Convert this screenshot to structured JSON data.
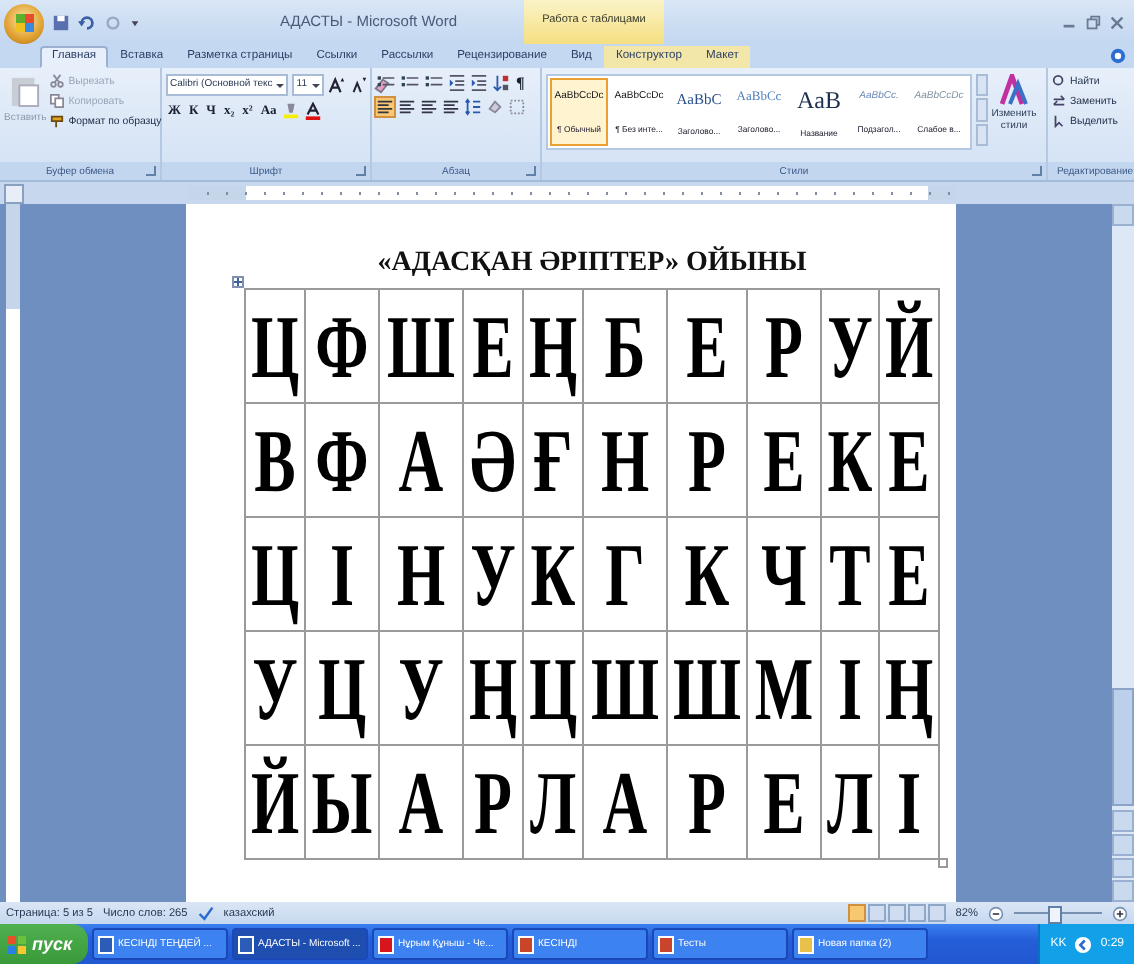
{
  "title_bar": {
    "title": "АДАСТЫ - Microsoft Word",
    "context_tab": "Работа с таблицами"
  },
  "tabs": [
    {
      "label": "Главная",
      "selected": true,
      "kind": "main"
    },
    {
      "label": "Вставка",
      "selected": false,
      "kind": "main"
    },
    {
      "label": "Разметка страницы",
      "selected": false,
      "kind": "main"
    },
    {
      "label": "Ссылки",
      "selected": false,
      "kind": "main"
    },
    {
      "label": "Рассылки",
      "selected": false,
      "kind": "main"
    },
    {
      "label": "Рецензирование",
      "selected": false,
      "kind": "main"
    },
    {
      "label": "Вид",
      "selected": false,
      "kind": "main"
    },
    {
      "label": "Конструктор",
      "selected": false,
      "kind": "context"
    },
    {
      "label": "Макет",
      "selected": false,
      "kind": "context"
    }
  ],
  "clipboard": {
    "paste": "Вставить",
    "items": [
      {
        "label": "Вырезать",
        "disabled": true,
        "kind": "cut"
      },
      {
        "label": "Копировать",
        "disabled": true,
        "kind": "copy"
      },
      {
        "label": "Формат по образцу",
        "disabled": false,
        "kind": "brush"
      }
    ],
    "caption": "Буфер обмена"
  },
  "font": {
    "font_name": "Calibri (Основной текс",
    "size": "11",
    "buttons": [
      "Ж",
      "К",
      "Ч",
      "x₂",
      "x²",
      "Aa"
    ],
    "caption": "Шрифт"
  },
  "paragraph": {
    "show_marks": "¶",
    "alignment": [
      {
        "selected": true
      },
      {
        "selected": false
      },
      {
        "selected": false
      },
      {
        "selected": false
      }
    ],
    "caption": "Абзац"
  },
  "styles": {
    "items": [
      {
        "sample": "AaBbCcDc",
        "name": "¶ Обычный",
        "selected": true,
        "kind": "normal"
      },
      {
        "sample": "AaBbCcDc",
        "name": "¶ Без инте...",
        "selected": false,
        "kind": "normal"
      },
      {
        "sample": "AaBbC",
        "name": "Заголово...",
        "selected": false,
        "kind": "heading1"
      },
      {
        "sample": "AaBbCc",
        "name": "Заголово...",
        "selected": false,
        "kind": "heading2"
      },
      {
        "sample": "AaB",
        "name": "Название",
        "selected": false,
        "kind": "title"
      },
      {
        "sample": "AaBbCc.",
        "name": "Подзагол...",
        "selected": false,
        "kind": "subtitle"
      },
      {
        "sample": "AaBbCcDc",
        "name": "Слабое в...",
        "selected": false,
        "kind": "subtle"
      }
    ],
    "change": "Изменить стили",
    "caption": "Стили"
  },
  "editing": {
    "items": [
      {
        "label": "Найти",
        "kind": "find"
      },
      {
        "label": "Заменить",
        "kind": "replace"
      },
      {
        "label": "Выделить",
        "kind": "select"
      }
    ],
    "caption": "Редактирование"
  },
  "document": {
    "heading": "«АДАСҚАН ӘРІПТЕР» ОЙЫНЫ",
    "table": {
      "rows": [
        [
          "Ц",
          "Ф",
          "Ш",
          "Е",
          "Ң",
          "Б",
          "Е",
          "Р",
          "У",
          "Й"
        ],
        [
          "В",
          "Ф",
          "А",
          "Ә",
          "Ғ",
          "Н",
          "Р",
          "Е",
          "К",
          "Е"
        ],
        [
          "Ц",
          "І",
          "Н",
          "У",
          "К",
          "Г",
          "К",
          "Ч",
          "Т",
          "Е"
        ],
        [
          "У",
          "Ц",
          "У",
          "Ң",
          "Ц",
          "Ш",
          "Ш",
          "М",
          "І",
          "Ң"
        ],
        [
          "Й",
          "Ы",
          "А",
          "Р",
          "Л",
          "А",
          "Р",
          "Е",
          "Л",
          "І"
        ]
      ]
    }
  },
  "status_bar": {
    "page": "Страница: 5 из 5",
    "words": "Число слов: 265",
    "language": "казахский",
    "zoom": "82%",
    "zoom_slider": {
      "level": 0.45
    }
  },
  "taskbar": {
    "start": "пуск",
    "items": [
      {
        "label": "КЕСІНДІ ТЕҢДЕЙ ...",
        "selected": false,
        "kind": "word"
      },
      {
        "label": "АДАСТЫ - Microsoft ...",
        "selected": true,
        "kind": "word"
      },
      {
        "label": "Нұрым Құныш - Че...",
        "selected": false,
        "kind": "opera"
      },
      {
        "label": "КЕСІНДІ",
        "selected": false,
        "kind": "ppt"
      },
      {
        "label": "Тесты",
        "selected": false,
        "kind": "ppt"
      },
      {
        "label": "Новая папка (2)",
        "selected": false,
        "kind": "folder"
      }
    ],
    "language": "KK",
    "clock": "0:29"
  }
}
